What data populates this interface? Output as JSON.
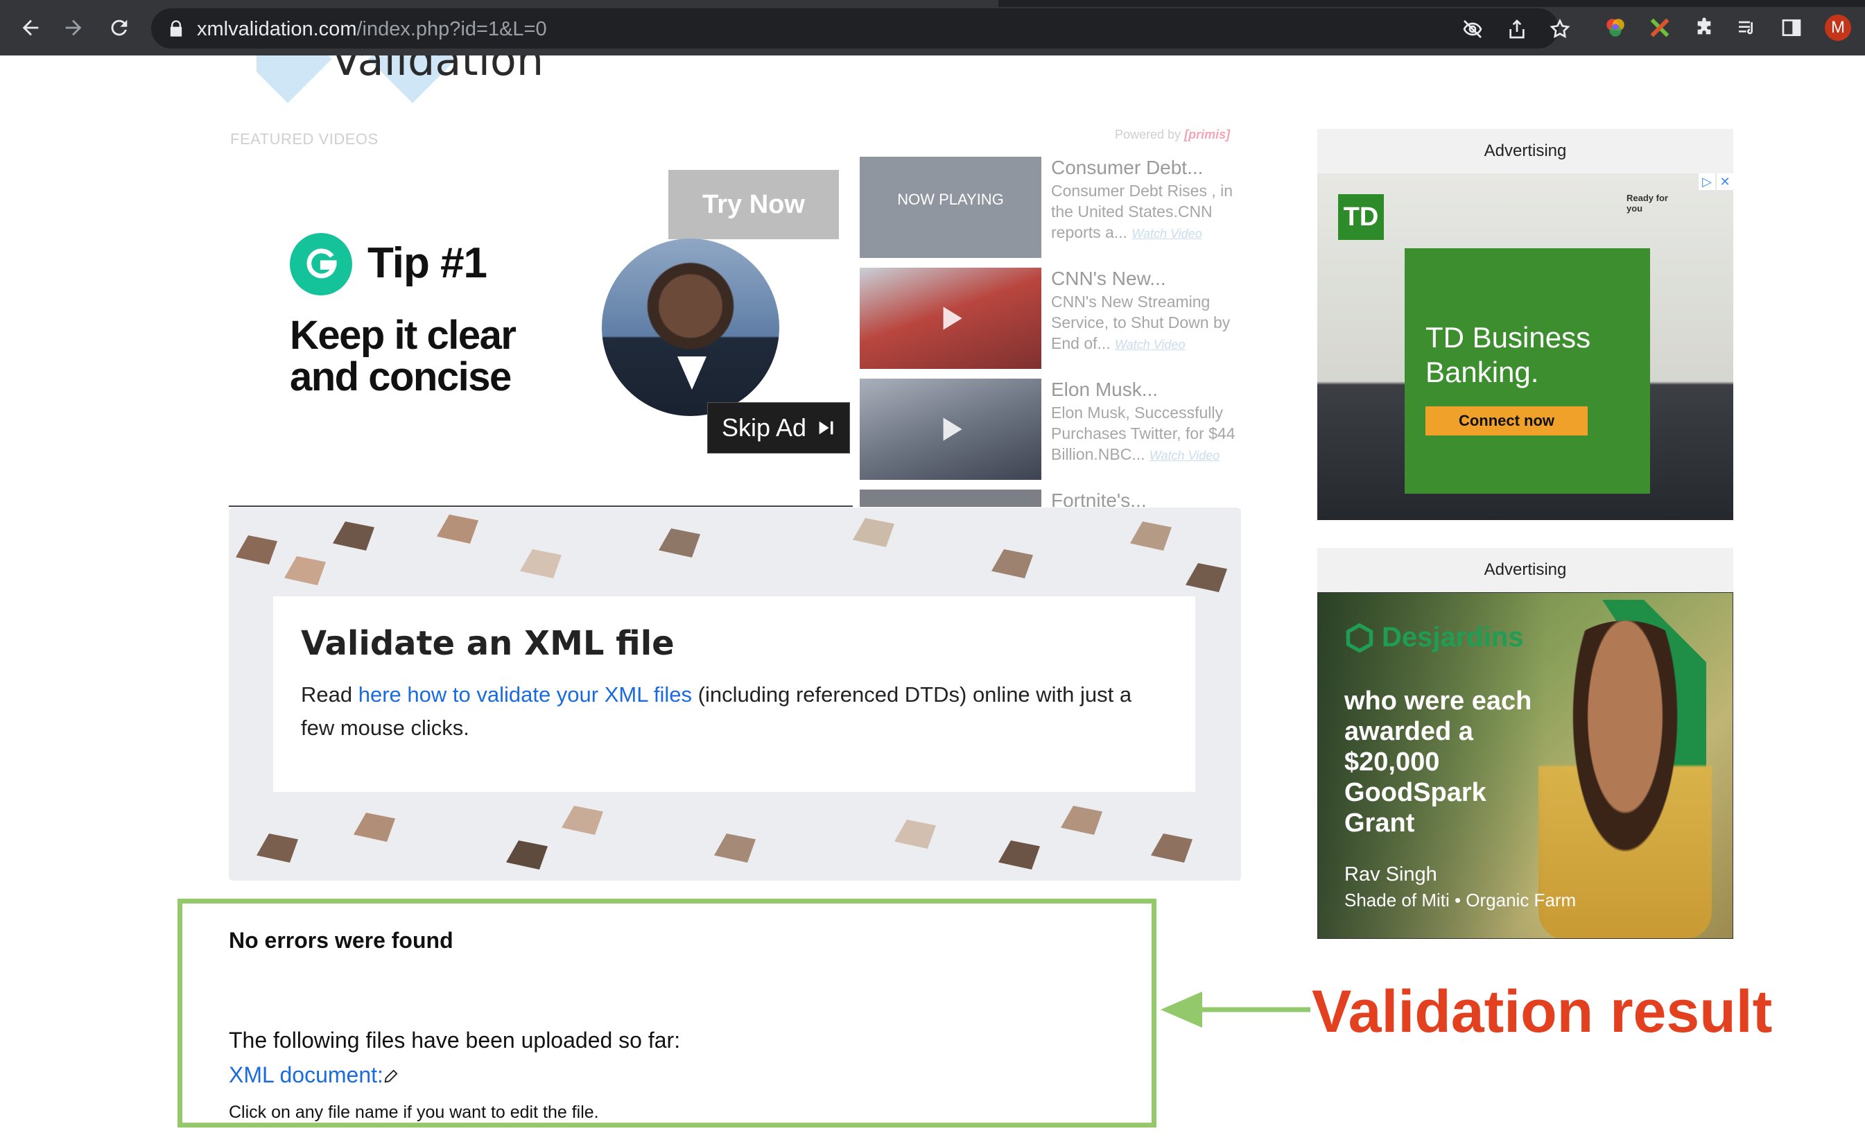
{
  "browser": {
    "url_host": "xmlvalidation.com",
    "url_path": "/index.php?id=1&L=0",
    "profile_initial": "M"
  },
  "site": {
    "logo_text": "Validation"
  },
  "featured": {
    "label": "FEATURED VIDEOS",
    "powered_by": "Powered by",
    "powered_brand": "[primis]"
  },
  "video_ad": {
    "try_now": "Try Now",
    "tip_title": "Tip #1",
    "tip_text": "Keep it clear and concise",
    "skip_ad": "Skip Ad"
  },
  "playlist": [
    {
      "title": "Consumer Debt...",
      "desc": "Consumer Debt Rises , in the United States.CNN reports a...",
      "watch": "Watch Video",
      "now_playing": "NOW PLAYING",
      "thumb_color": "#8f969f"
    },
    {
      "title": "CNN's New...",
      "desc": "CNN's New Streaming Service, to Shut Down by End of...",
      "watch": "Watch Video",
      "thumb_color": "#b9463f"
    },
    {
      "title": "Elon Musk...",
      "desc": "Elon Musk, Successfully Purchases Twitter, for $44 Billion.NBC...",
      "watch": "Watch Video",
      "thumb_color": "#6d7482"
    },
    {
      "title": "Fortnite's...",
      "desc": "",
      "watch": "",
      "thumb_color": "#7c7f86"
    }
  ],
  "hero": {
    "heading": "Validate an XML file",
    "text_before": "Read ",
    "link_text": "here how to validate your XML files",
    "text_after": " (including referenced DTDs) online with just a few mouse clicks."
  },
  "result": {
    "title": "No errors were found",
    "files_text": "The following files have been uploaded so far:",
    "doc_link": "XML document:",
    "hint": "Click on any file name if you want to edit the file."
  },
  "annotation": {
    "label": "Validation result",
    "color": "#e2401f",
    "box_color": "#93c96a"
  },
  "ads": {
    "label": "Advertising",
    "td": {
      "logo": "TD",
      "headline": "TD Business Banking.",
      "cta": "Connect now",
      "ready": "Ready for you"
    },
    "desjardins": {
      "logo": "Desjardins",
      "headline": "who were each awarded a $20,000 GoodSpark Grant",
      "name": "Rav Singh",
      "subtitle": "Shade of Miti • Organic Farm"
    }
  }
}
